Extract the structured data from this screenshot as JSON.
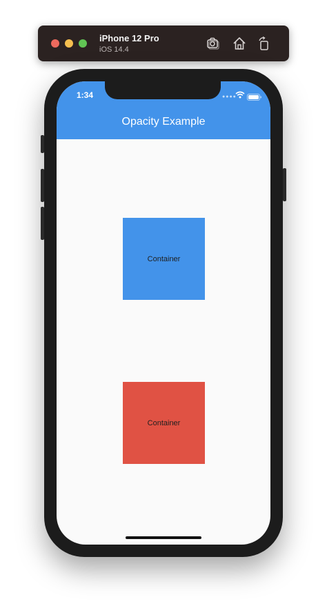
{
  "simulator": {
    "device_name": "iPhone 12 Pro",
    "os_version": "iOS 14.4",
    "toolbar_icons": [
      "screenshot-icon",
      "home-icon",
      "rotate-icon"
    ],
    "traffic_light_colors": {
      "close": "#ed6a5e",
      "minimize": "#f5bf4f",
      "zoom": "#61c554"
    }
  },
  "status_bar": {
    "time": "1:34",
    "icons": [
      "wifi-icon",
      "battery-icon"
    ]
  },
  "app_bar": {
    "title": "Opacity Example",
    "color": "#4393ea"
  },
  "containers": [
    {
      "label": "Container",
      "color": "#4393ea"
    },
    {
      "label": "Container",
      "color": "#e05244"
    }
  ]
}
